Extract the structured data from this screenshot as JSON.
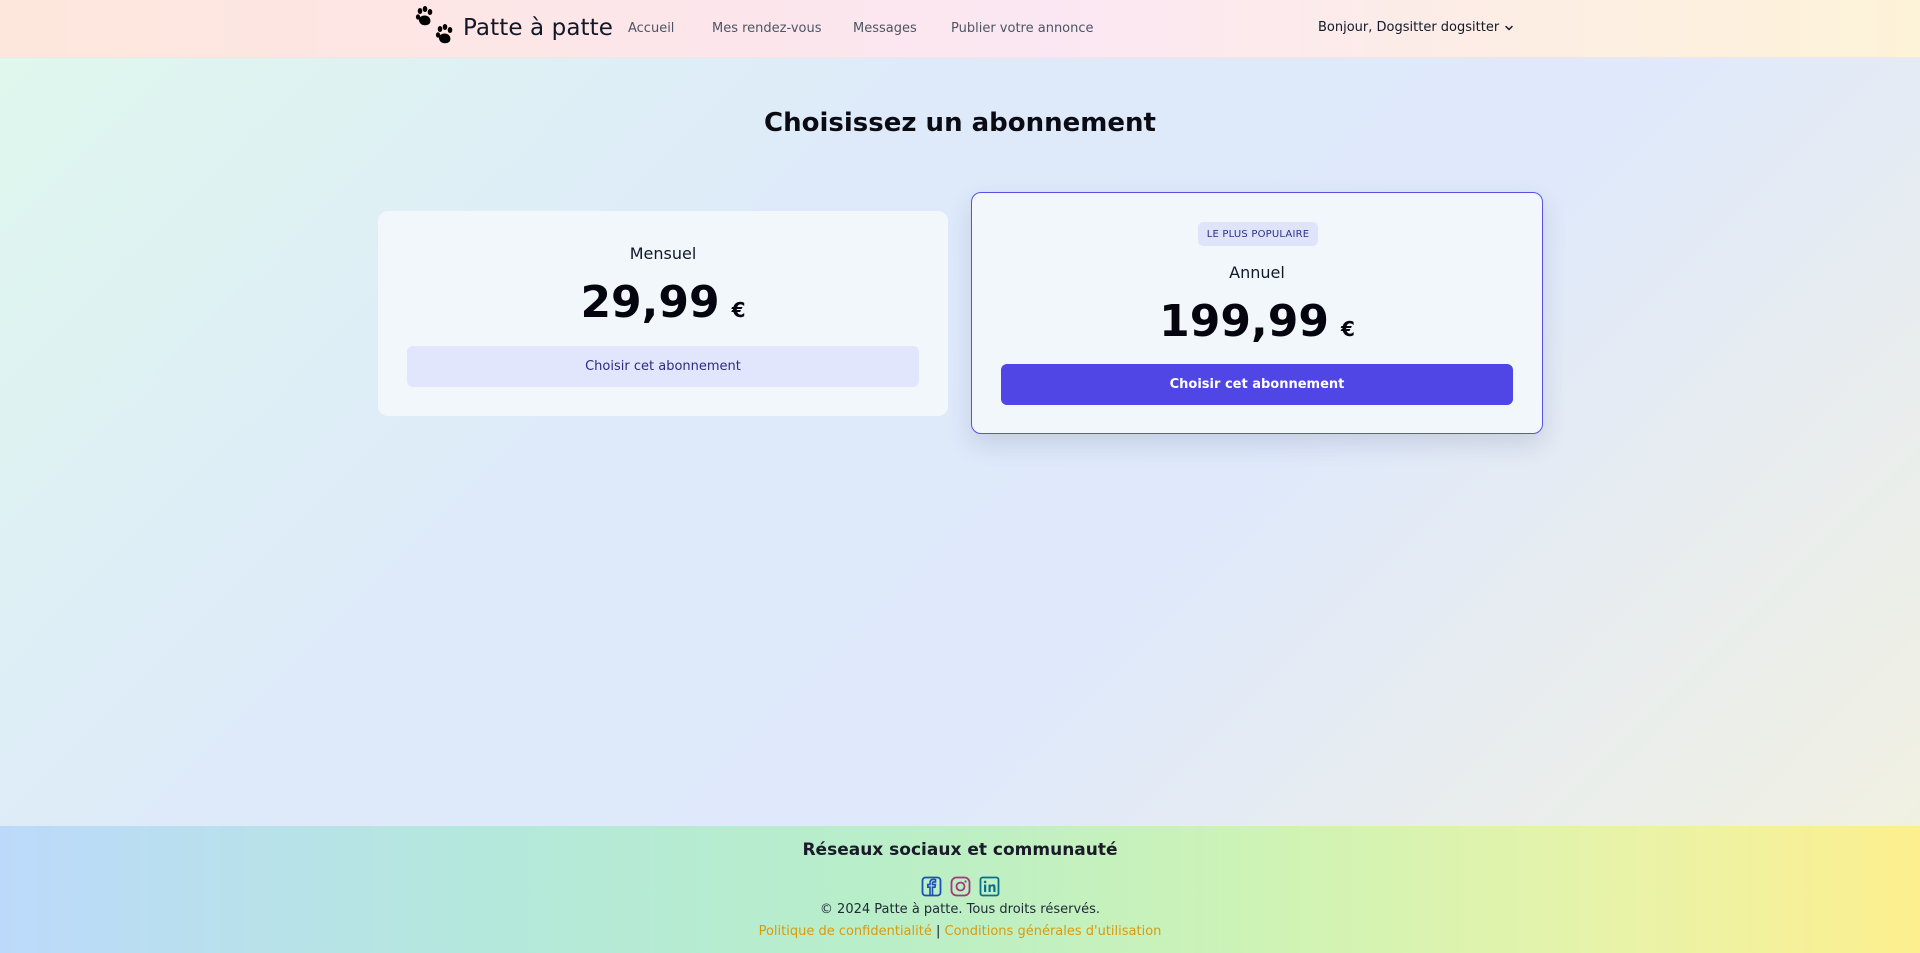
{
  "header": {
    "brand": "Patte à patte",
    "nav": [
      "Accueil",
      "Mes rendez-vous",
      "Messages",
      "Publier votre annonce"
    ],
    "user_greeting": "Bonjour, Dogsitter dogsitter"
  },
  "main": {
    "title": "Choisissez un abonnement",
    "plans": [
      {
        "name": "Mensuel",
        "price": "29,99",
        "currency": "€",
        "button": "Choisir cet abonnement"
      },
      {
        "badge": "LE PLUS POPULAIRE",
        "name": "Annuel",
        "price": "199,99",
        "currency": "€",
        "button": "Choisir cet abonnement"
      }
    ]
  },
  "footer": {
    "title": "Réseaux sociaux et communauté",
    "socials": [
      "facebook-icon",
      "instagram-icon",
      "linkedin-icon"
    ],
    "copyright": "© 2024 Patte à patte. Tous droits réservés.",
    "privacy": "Politique de confidentialité",
    "separator": "|",
    "terms": "Conditions générales d'utilisation"
  },
  "colors": {
    "primary": "#4f46e5",
    "link": "#d99a0e",
    "facebook": "#1d4fb8",
    "instagram": "#a3387a",
    "linkedin": "#0a6f8c"
  }
}
